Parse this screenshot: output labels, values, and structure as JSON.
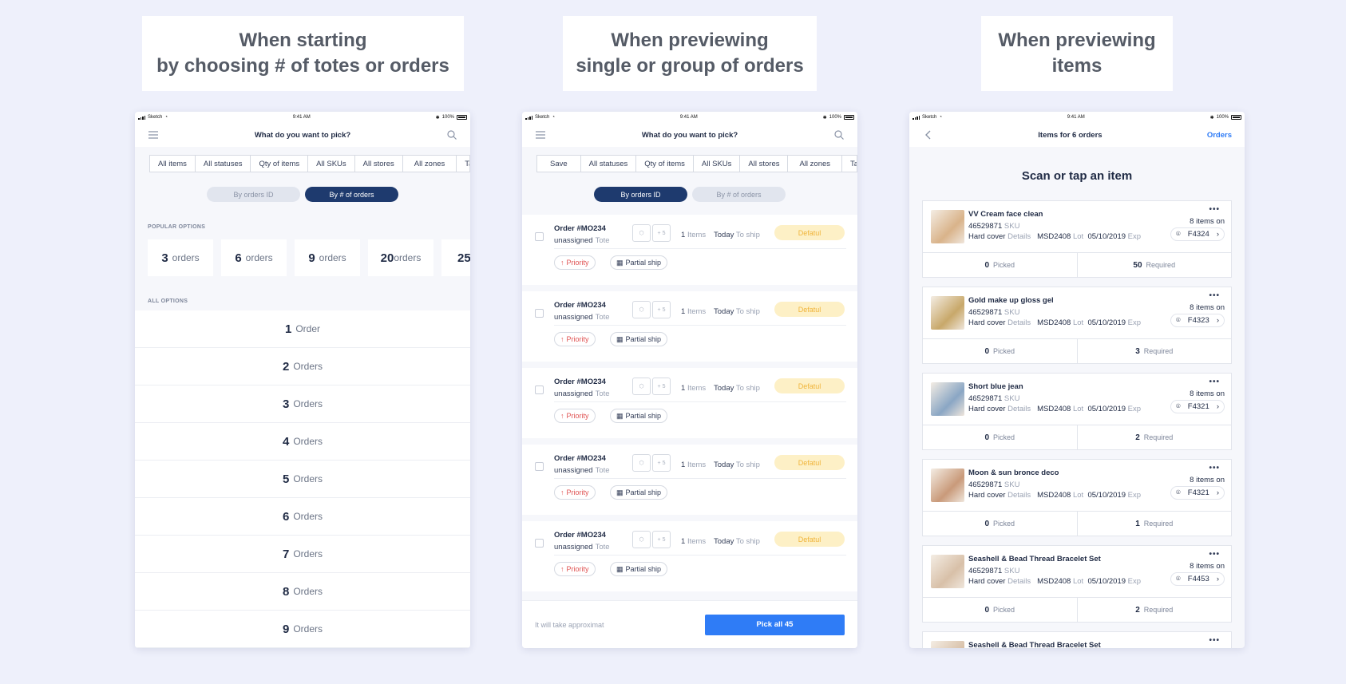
{
  "captions": [
    "When starting\nby choosing # of totes or orders",
    "When previewing\nsingle or group of orders",
    "When previewing\nitems"
  ],
  "statusbar": {
    "carrier": "Sketch",
    "time": "9:41 AM",
    "battery": "100%"
  },
  "screen1": {
    "title": "What do you want to pick?",
    "filters": [
      "All items",
      "All statuses",
      "Qty of items",
      "All SKUs",
      "All stores",
      "All zones",
      "Tags"
    ],
    "segment": {
      "left": "By orders ID",
      "right": "By # of orders",
      "active": "right"
    },
    "popular_label": "POPULAR OPTIONS",
    "popular": [
      {
        "num": "3",
        "unit": "orders"
      },
      {
        "num": "6",
        "unit": "orders"
      },
      {
        "num": "9",
        "unit": "orders"
      },
      {
        "num": "20",
        "unit": "orders"
      },
      {
        "num": "25",
        "unit": ""
      }
    ],
    "all_label": "ALL OPTIONS",
    "options": [
      {
        "num": "1",
        "unit": "Order"
      },
      {
        "num": "2",
        "unit": "Orders"
      },
      {
        "num": "3",
        "unit": "Orders"
      },
      {
        "num": "4",
        "unit": "Orders"
      },
      {
        "num": "5",
        "unit": "Orders"
      },
      {
        "num": "6",
        "unit": "Orders"
      },
      {
        "num": "7",
        "unit": "Orders"
      },
      {
        "num": "8",
        "unit": "Orders"
      },
      {
        "num": "9",
        "unit": "Orders"
      }
    ]
  },
  "screen2": {
    "title": "What do you want to pick?",
    "filters": [
      "Save",
      "All statuses",
      "Qty of items",
      "All SKUs",
      "All stores",
      "All zones",
      "Tags"
    ],
    "segment": {
      "left": "By orders ID",
      "right": "By # of orders",
      "active": "left"
    },
    "orders": [
      {
        "name": "Order #MO234",
        "assignee": "unassigned",
        "assignee_label": "Tote",
        "tote_more": "+ 5",
        "items": "1",
        "items_label": "Items",
        "day": "Today",
        "day_label": "To ship",
        "status": "Defatul",
        "priority": "Priority",
        "partial": "Partial ship"
      },
      {
        "name": "Order #MO234",
        "assignee": "unassigned",
        "assignee_label": "Tote",
        "tote_more": "+ 5",
        "items": "1",
        "items_label": "Items",
        "day": "Today",
        "day_label": "To ship",
        "status": "Defatul",
        "priority": "Priority",
        "partial": "Partial ship"
      },
      {
        "name": "Order #MO234",
        "assignee": "unassigned",
        "assignee_label": "Tote",
        "tote_more": "+ 5",
        "items": "1",
        "items_label": "Items",
        "day": "Today",
        "day_label": "To ship",
        "status": "Defatul",
        "priority": "Priority",
        "partial": "Partial ship"
      },
      {
        "name": "Order #MO234",
        "assignee": "unassigned",
        "assignee_label": "Tote",
        "tote_more": "+ 5",
        "items": "1",
        "items_label": "Items",
        "day": "Today",
        "day_label": "To ship",
        "status": "Defatul",
        "priority": "Priority",
        "partial": "Partial ship"
      },
      {
        "name": "Order #MO234",
        "assignee": "unassigned",
        "assignee_label": "Tote",
        "tote_more": "+ 5",
        "items": "1",
        "items_label": "Items",
        "day": "Today",
        "day_label": "To ship",
        "status": "Defatul",
        "priority": "Priority",
        "partial": "Partial ship"
      }
    ],
    "footer_note": "It will take approximat",
    "pick_button": "Pick all 45"
  },
  "screen3": {
    "title": "Items for 6 orders",
    "right_link": "Orders",
    "heading": "Scan or tap an item",
    "items": [
      {
        "name": "VV Cream face clean",
        "sku": "46529871",
        "sku_label": "SKU",
        "type": "Hard cover",
        "details_label": "Details",
        "lot": "MSD2408",
        "lot_label": "Lot",
        "date": "05/10/2019",
        "exp_label": "Exp",
        "on": "8 items on",
        "loc": "F4324",
        "picked": "0",
        "picked_label": "Picked",
        "required": "50",
        "required_label": "Required",
        "thumb_color": "#d9b38a"
      },
      {
        "name": "Gold make up gloss gel",
        "sku": "46529871",
        "sku_label": "SKU",
        "type": "Hard cover",
        "details_label": "Details",
        "lot": "MSD2408",
        "lot_label": "Lot",
        "date": "05/10/2019",
        "exp_label": "Exp",
        "on": "8 items on",
        "loc": "F4323",
        "picked": "0",
        "picked_label": "Picked",
        "required": "3",
        "required_label": "Required",
        "thumb_color": "#c8a86a"
      },
      {
        "name": "Short blue jean",
        "sku": "46529871",
        "sku_label": "SKU",
        "type": "Hard cover",
        "details_label": "Details",
        "lot": "MSD2408",
        "lot_label": "Lot",
        "date": "05/10/2019",
        "exp_label": "Exp",
        "on": "8 items on",
        "loc": "F4321",
        "picked": "0",
        "picked_label": "Picked",
        "required": "2",
        "required_label": "Required",
        "thumb_color": "#8aa6c4"
      },
      {
        "name": "Moon & sun bronce deco",
        "sku": "46529871",
        "sku_label": "SKU",
        "type": "Hard cover",
        "details_label": "Details",
        "lot": "MSD2408",
        "lot_label": "Lot",
        "date": "05/10/2019",
        "exp_label": "Exp",
        "on": "8 items on",
        "loc": "F4321",
        "picked": "0",
        "picked_label": "Picked",
        "required": "1",
        "required_label": "Required",
        "thumb_color": "#c99a7a"
      },
      {
        "name": "Seashell & Bead Thread Bracelet Set",
        "sku": "46529871",
        "sku_label": "SKU",
        "type": "Hard cover",
        "details_label": "Details",
        "lot": "MSD2408",
        "lot_label": "Lot",
        "date": "05/10/2019",
        "exp_label": "Exp",
        "on": "8 items on",
        "loc": "F4453",
        "picked": "0",
        "picked_label": "Picked",
        "required": "2",
        "required_label": "Required",
        "thumb_color": "#d8c0a8"
      },
      {
        "name": "Seashell & Bead Thread Bracelet Set",
        "sku": "",
        "sku_label": "",
        "type": "",
        "details_label": "",
        "lot": "",
        "lot_label": "",
        "date": "",
        "exp_label": "",
        "on": "",
        "loc": "",
        "picked": "",
        "picked_label": "",
        "required": "",
        "required_label": "",
        "thumb_color": "#d8c0a8"
      }
    ]
  },
  "colors": {
    "background": "#eef0fb",
    "primary": "#2f7cf6",
    "navy": "#1e3a6e",
    "warning_bg": "#fdf0c6",
    "warning_text": "#f0b43a",
    "priority": "#e05353"
  }
}
